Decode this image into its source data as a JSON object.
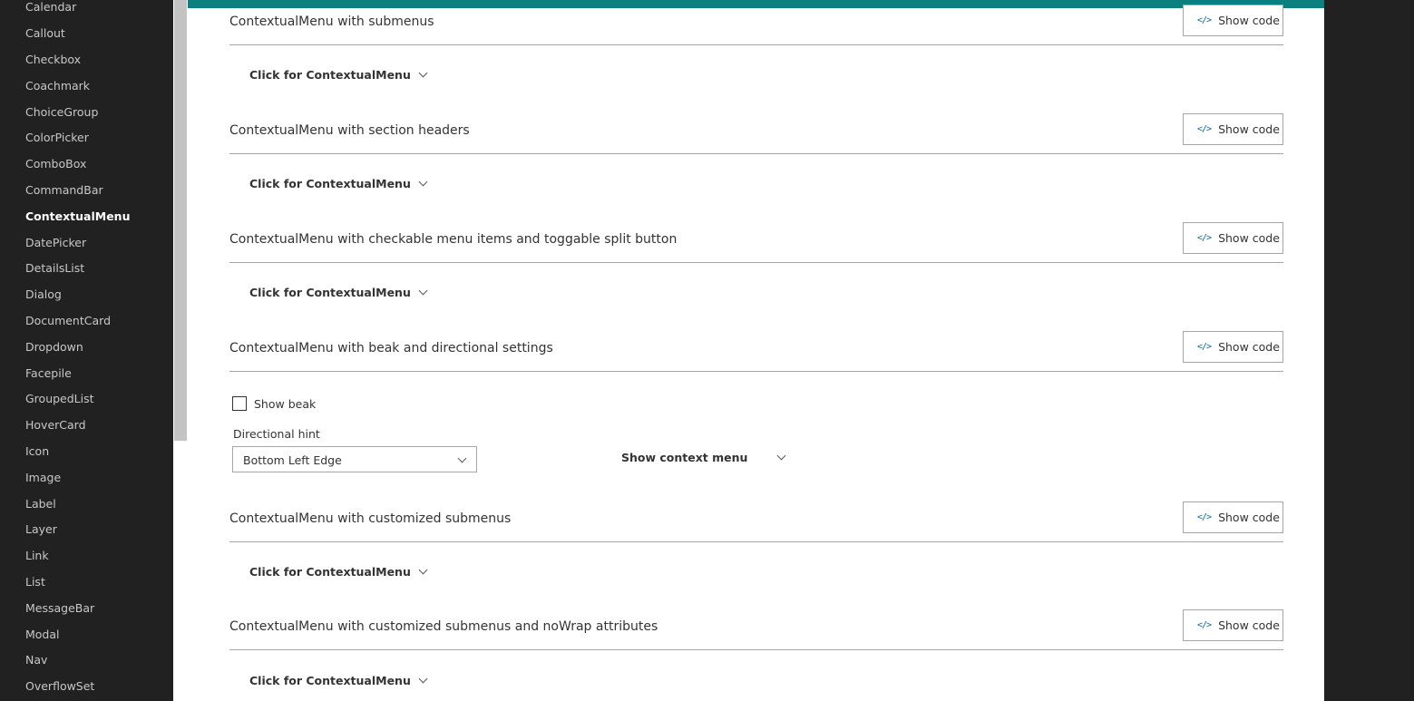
{
  "nav": {
    "items": [
      {
        "label": "Calendar",
        "active": false
      },
      {
        "label": "Callout",
        "active": false
      },
      {
        "label": "Checkbox",
        "active": false
      },
      {
        "label": "Coachmark",
        "active": false
      },
      {
        "label": "ChoiceGroup",
        "active": false
      },
      {
        "label": "ColorPicker",
        "active": false
      },
      {
        "label": "ComboBox",
        "active": false
      },
      {
        "label": "CommandBar",
        "active": false
      },
      {
        "label": "ContextualMenu",
        "active": true
      },
      {
        "label": "DatePicker",
        "active": false
      },
      {
        "label": "DetailsList",
        "active": false
      },
      {
        "label": "Dialog",
        "active": false
      },
      {
        "label": "DocumentCard",
        "active": false
      },
      {
        "label": "Dropdown",
        "active": false
      },
      {
        "label": "Facepile",
        "active": false
      },
      {
        "label": "GroupedList",
        "active": false
      },
      {
        "label": "HoverCard",
        "active": false
      },
      {
        "label": "Icon",
        "active": false
      },
      {
        "label": "Image",
        "active": false
      },
      {
        "label": "Label",
        "active": false
      },
      {
        "label": "Layer",
        "active": false
      },
      {
        "label": "Link",
        "active": false
      },
      {
        "label": "List",
        "active": false
      },
      {
        "label": "MessageBar",
        "active": false
      },
      {
        "label": "Modal",
        "active": false
      },
      {
        "label": "Nav",
        "active": false
      },
      {
        "label": "OverflowSet",
        "active": false
      }
    ]
  },
  "theme": {
    "accent": "#0b807e",
    "nav_bg": "#212121"
  },
  "show_code_label": "Show code",
  "code_icon": "code-icon",
  "menu_trigger_label": "Click for ContextualMenu",
  "sections": [
    {
      "title": "ContextualMenu with submenus"
    },
    {
      "title": "ContextualMenu with section headers"
    },
    {
      "title": "ContextualMenu with checkable menu items and toggable split button"
    },
    {
      "title": "ContextualMenu with beak and directional settings"
    },
    {
      "title": "ContextualMenu with customized submenus"
    },
    {
      "title": "ContextualMenu with customized submenus and noWrap attributes"
    }
  ],
  "beak": {
    "checkbox_label": "Show beak",
    "checked": false,
    "hint_label": "Directional hint",
    "hint_value": "Bottom Left Edge",
    "context_button_label": "Show context menu"
  }
}
